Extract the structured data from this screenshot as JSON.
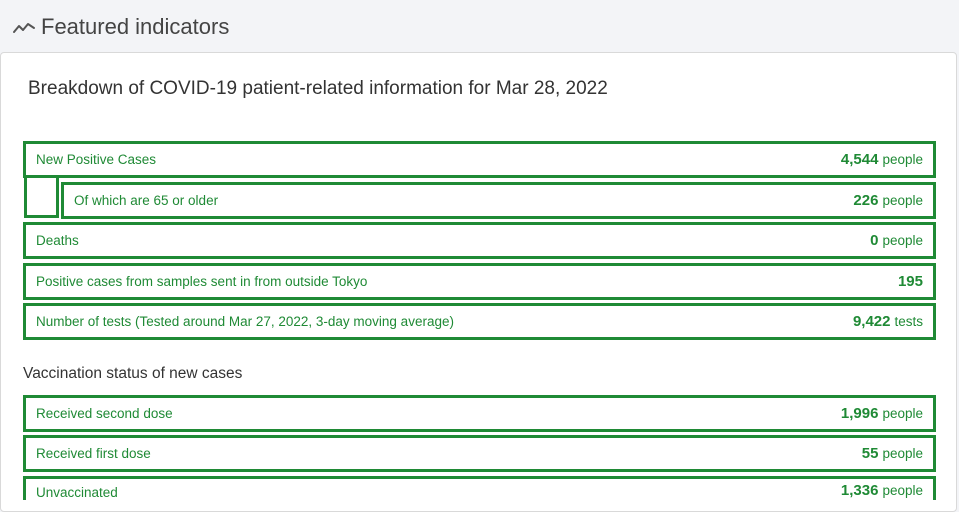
{
  "header": {
    "title": "Featured indicators",
    "icon": "trend-chart-icon"
  },
  "card": {
    "title": "Breakdown of COVID-19 patient-related information for Mar 28, 2022"
  },
  "indicators": [
    {
      "label": "New Positive Cases",
      "value": "4,544",
      "unit": "people"
    },
    {
      "label": "Of which are 65 or older",
      "value": "226",
      "unit": "people"
    },
    {
      "label": "Deaths",
      "value": "0",
      "unit": "people"
    },
    {
      "label": "Positive cases from samples sent in from outside Tokyo",
      "value": "195",
      "unit": ""
    },
    {
      "label": "Number of tests (Tested around Mar 27, 2022, 3-day moving average)",
      "value": "9,422",
      "unit": "tests"
    }
  ],
  "vaccination": {
    "heading": "Vaccination status of new cases",
    "rows": [
      {
        "label": "Received second dose",
        "value": "1,996",
        "unit": "people"
      },
      {
        "label": "Received first dose",
        "value": "55",
        "unit": "people"
      },
      {
        "label": "Unvaccinated",
        "value": "1,336",
        "unit": "people"
      }
    ]
  },
  "colors": {
    "accent": "#1f8a35",
    "background": "#f3f4f7"
  }
}
